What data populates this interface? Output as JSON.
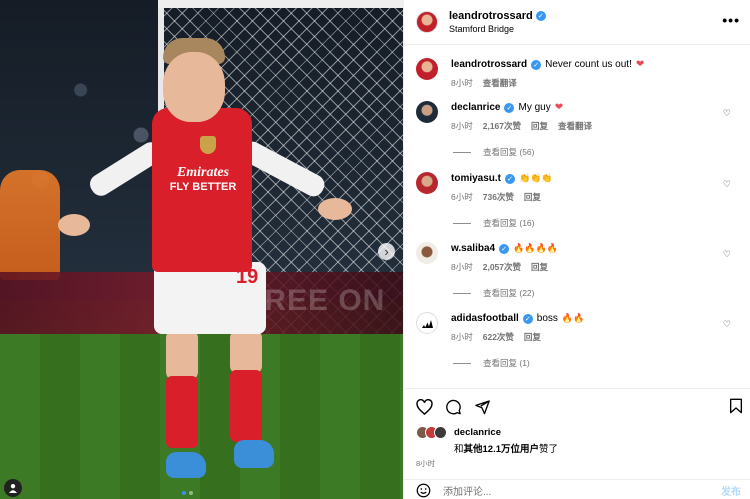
{
  "post": {
    "photo_alt": "Player in red and white kit celebrating in front of goal net",
    "ad_text": "FREE ON",
    "sponsor_line1": "Emirates",
    "sponsor_line2": "FLY BETTER",
    "shirt_number": "19",
    "carousel_next": "›",
    "profile_icon": "person-icon"
  },
  "header": {
    "username": "leandrotrossard",
    "location": "Stamford Bridge",
    "more": "•••"
  },
  "caption": {
    "username": "leandrotrossard",
    "text": "Never count us out!",
    "time": "8小时",
    "translate": "查看翻译"
  },
  "comments": [
    {
      "username": "declanrice",
      "text": "My guy",
      "emoji": "❤",
      "time": "8小时",
      "likes": "2,167次赞",
      "reply": "回复",
      "translate": "查看翻译",
      "replies": "查看回复 (56)"
    },
    {
      "username": "tomiyasu.t",
      "text": "",
      "emoji": "👏👏👏",
      "time": "6小时",
      "likes": "736次赞",
      "reply": "回复",
      "replies": "查看回复 (16)"
    },
    {
      "username": "w.saliba4",
      "text": "",
      "emoji": "🔥🔥🔥🔥",
      "time": "8小时",
      "likes": "2,057次赞",
      "reply": "回复",
      "replies": "查看回复 (22)"
    },
    {
      "username": "adidasfootball",
      "text": "boss",
      "emoji": "🔥🔥",
      "time": "8小时",
      "likes": "622次赞",
      "reply": "回复",
      "replies": "查看回复 (1)"
    }
  ],
  "footer": {
    "liked_by": "declanrice",
    "and": "和",
    "others": "其他12.1万位用户",
    "liked": "赞了",
    "time": "8小时",
    "placeholder": "添加评论...",
    "post_btn": "发布"
  },
  "colors": {
    "accent": "#3897f0",
    "heart": "#ed4956",
    "secondary_text": "#737373"
  }
}
